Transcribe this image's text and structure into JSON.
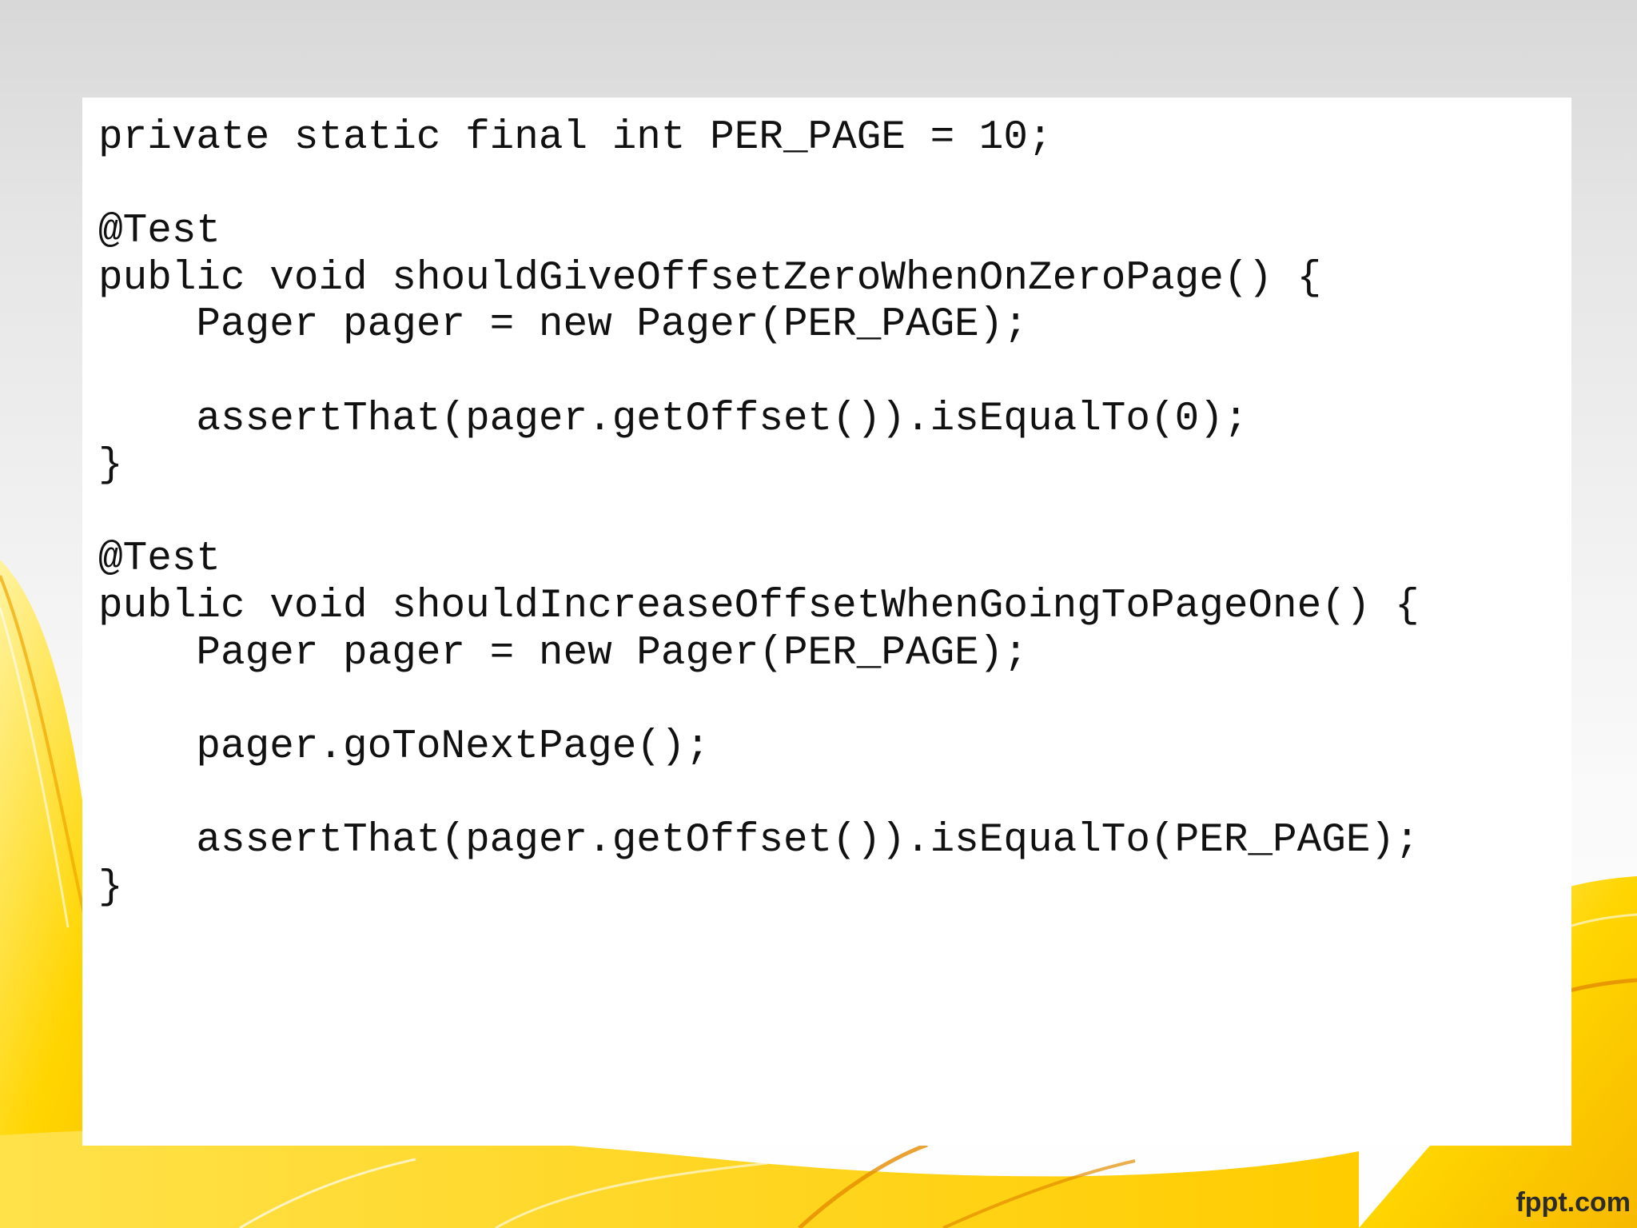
{
  "slide": {
    "code_lines": [
      "private static final int PER_PAGE = 10;",
      "",
      "@Test",
      "public void shouldGiveOffsetZeroWhenOnZeroPage() {",
      "    Pager pager = new Pager(PER_PAGE);",
      "",
      "    assertThat(pager.getOffset()).isEqualTo(0);",
      "}",
      "",
      "@Test",
      "public void shouldIncreaseOffsetWhenGoingToPageOne() {",
      "    Pager pager = new Pager(PER_PAGE);",
      "",
      "    pager.goToNextPage();",
      "",
      "    assertThat(pager.getOffset()).isEqualTo(PER_PAGE);",
      "}"
    ]
  },
  "footer": {
    "brand_text": "fppt.com"
  },
  "colors": {
    "accent_yellow": "#ffd400",
    "accent_orange": "#f5a300",
    "text": "#111111",
    "panel": "#ffffff"
  }
}
